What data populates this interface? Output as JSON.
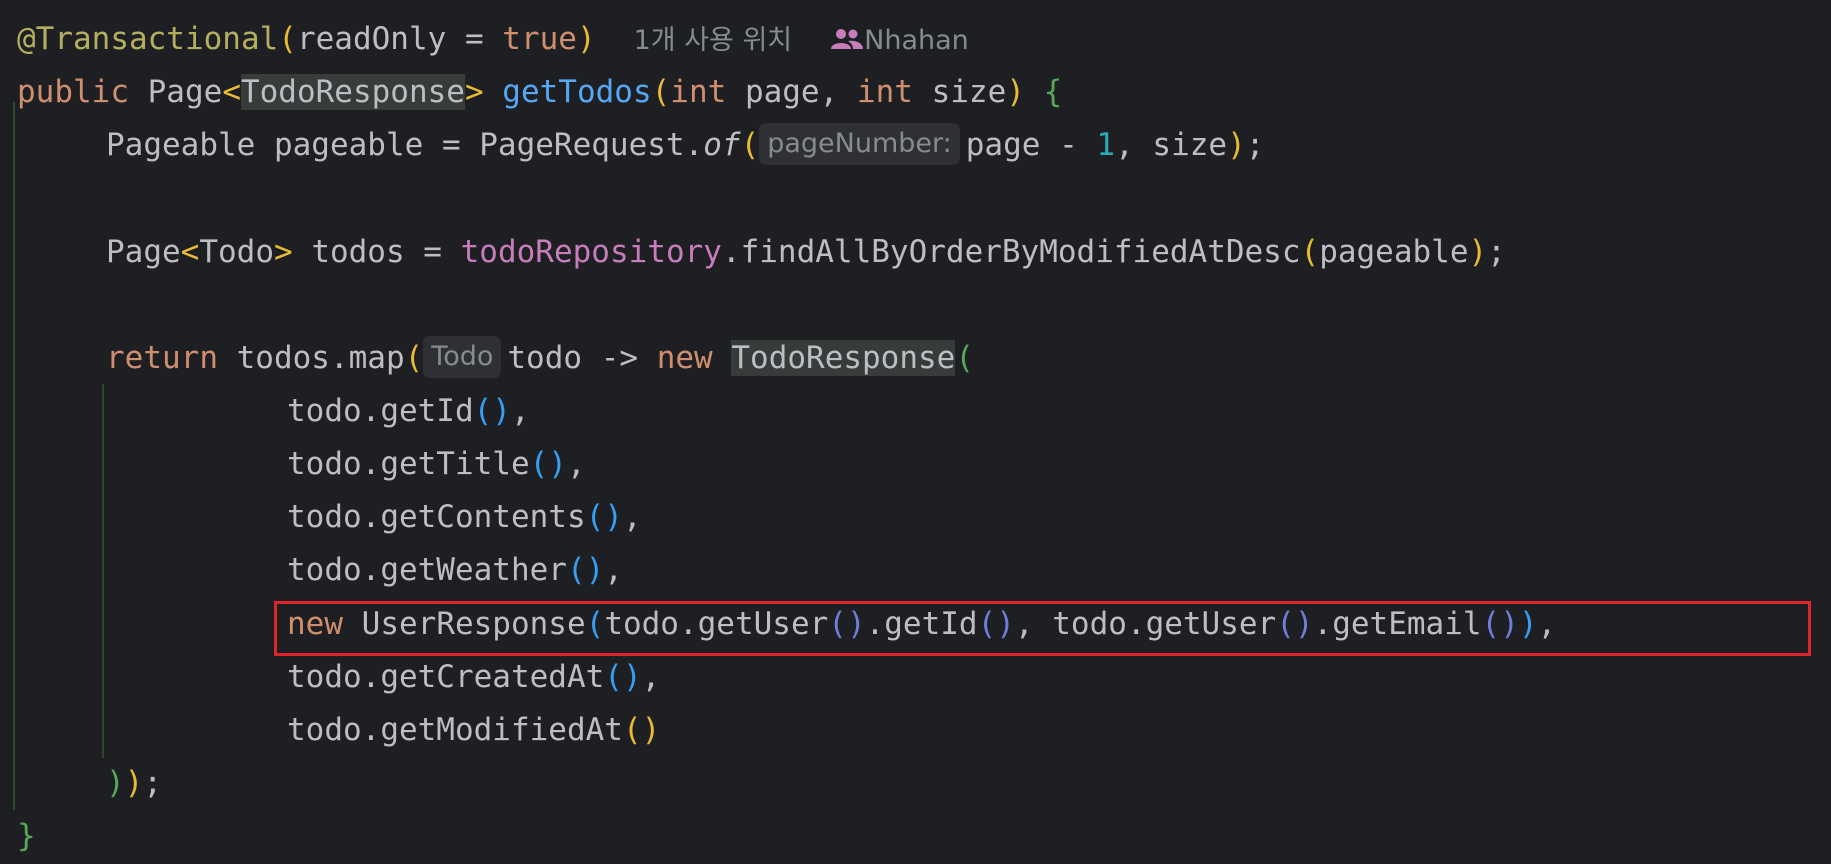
{
  "editor": {
    "codelens": {
      "usages": "1개 사용 위치",
      "author": "Nhahan"
    },
    "inlay_hints": {
      "param_name": "pageNumber:",
      "lambda_type": "Todo"
    },
    "colors": {
      "background": "#1e1f22",
      "keyword": "#cf8e6d",
      "annotation": "#b3ae60",
      "method_decl": "#56a8f5",
      "number": "#2aacb8",
      "field": "#c77dbb",
      "text": "#bcbec4",
      "highlight_border": "#e0242e"
    },
    "code": {
      "l1_annotation": "@Transactional",
      "l1_paren_open": "(",
      "l1_param": "readOnly = ",
      "l1_true": "true",
      "l1_paren_close": ")",
      "l2_public": "public",
      "l2_page": " Page",
      "l2_lt": "<",
      "l2_type": "TodoResponse",
      "l2_gt": ">",
      "l2_method": "getTodos",
      "l2_paren_open": "(",
      "l2_int1": "int",
      "l2_page_param": " page, ",
      "l2_int2": "int",
      "l2_size_param": " size",
      "l2_paren_close": ")",
      "l2_brace": "{",
      "l3_pre": "Pageable pageable = PageRequest.",
      "l3_of": "of",
      "l3_paren_open": "(",
      "l3_page": "page - ",
      "l3_one": "1",
      "l3_size": ", size",
      "l3_paren_close": ")",
      "l3_semi": ";",
      "l5_page": "Page",
      "l5_lt": "<",
      "l5_todo": "Todo",
      "l5_gt": ">",
      "l5_mid": " todos = ",
      "l5_repo": "todoRepository",
      "l5_call": ".findAllByOrderByModifiedAtDesc",
      "l5_paren_open": "(",
      "l5_arg": "pageable",
      "l5_paren_close": ")",
      "l5_semi": ";",
      "l7_return": "return",
      "l7_map": " todos.map",
      "l7_paren_open": "(",
      "l7_todo": "todo -> ",
      "l7_new": "new",
      "l7_type": "TodoResponse",
      "l7_paren_open2": "(",
      "l8_text": "todo.getId",
      "l8_parens": "()",
      "l8_comma": ",",
      "l9_text": "todo.getTitle",
      "l9_parens": "()",
      "l9_comma": ",",
      "l10_text": "todo.getContents",
      "l10_parens": "()",
      "l10_comma": ",",
      "l11_text": "todo.getWeather",
      "l11_parens": "()",
      "l11_comma": ",",
      "l12_new": "new",
      "l12_type": " UserResponse",
      "l12_paren_open": "(",
      "l12_a": "todo.getUser",
      "l12_p1": "()",
      "l12_b": ".getId",
      "l12_p2": "()",
      "l12_c": ", todo.getUser",
      "l12_p3": "()",
      "l12_d": ".getEmail",
      "l12_p4": "()",
      "l12_paren_close": ")",
      "l12_comma": ",",
      "l13_text": "todo.getCreatedAt",
      "l13_parens": "()",
      "l13_comma": ",",
      "l14_text": "todo.getModifiedAt",
      "l14_parens": "()",
      "l15_close_inner": ")",
      "l15_close_outer": ")",
      "l15_semi": ";",
      "l16_brace": "}"
    }
  }
}
